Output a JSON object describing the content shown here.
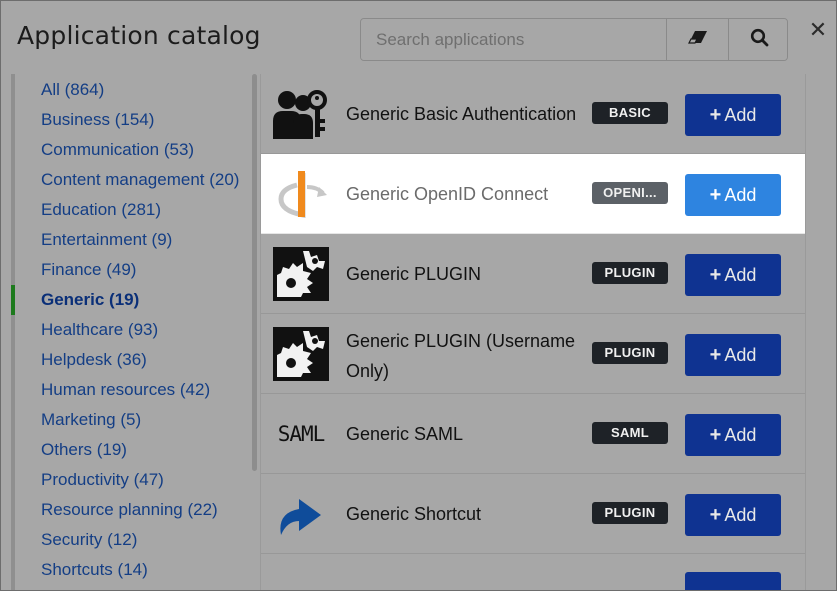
{
  "dialog": {
    "title": "Application catalog",
    "close_label": "✕"
  },
  "search": {
    "placeholder": "Search applications",
    "value": ""
  },
  "icons": {
    "clear": "eraser-icon",
    "search": "magnifier-icon",
    "close": "close-icon"
  },
  "sidebar": {
    "items": [
      {
        "label": "All (864)"
      },
      {
        "label": "Business (154)"
      },
      {
        "label": "Communication (53)"
      },
      {
        "label": "Content management (20)"
      },
      {
        "label": "Education (281)"
      },
      {
        "label": "Entertainment (9)"
      },
      {
        "label": "Finance (49)"
      },
      {
        "label": "Generic (19)",
        "active": true
      },
      {
        "label": "Healthcare (93)"
      },
      {
        "label": "Helpdesk (36)"
      },
      {
        "label": "Human resources (42)"
      },
      {
        "label": "Marketing (5)"
      },
      {
        "label": "Others (19)"
      },
      {
        "label": "Productivity (47)"
      },
      {
        "label": "Resource planning (22)"
      },
      {
        "label": "Security (12)"
      },
      {
        "label": "Shortcuts (14)"
      }
    ]
  },
  "apps": [
    {
      "name": "Generic Basic Authentication",
      "badge": "BASIC",
      "icon": "user-key-icon",
      "add_label": "Add"
    },
    {
      "name": "Generic OpenID Connect",
      "badge": "OPENI...",
      "icon": "openid-icon",
      "add_label": "Add",
      "highlighted": true
    },
    {
      "name": "Generic PLUGIN",
      "badge": "PLUGIN",
      "icon": "plugin-gear-icon",
      "add_label": "Add"
    },
    {
      "name": "Generic PLUGIN (Username Only)",
      "badge": "PLUGIN",
      "icon": "plugin-gear-icon",
      "add_label": "Add"
    },
    {
      "name": "Generic SAML",
      "badge": "SAML",
      "icon": "saml-icon",
      "icon_text": "SAML",
      "add_label": "Add"
    },
    {
      "name": "Generic Shortcut",
      "badge": "PLUGIN",
      "icon": "shortcut-arrow-icon",
      "add_label": "Add"
    }
  ],
  "colors": {
    "overlay": "#a7a7a7",
    "add_button": "#0f3391",
    "add_button_highlight": "#2e84e0",
    "badge": "#1e2227",
    "active_category": "#1d7a1d",
    "link": "#143e85"
  }
}
